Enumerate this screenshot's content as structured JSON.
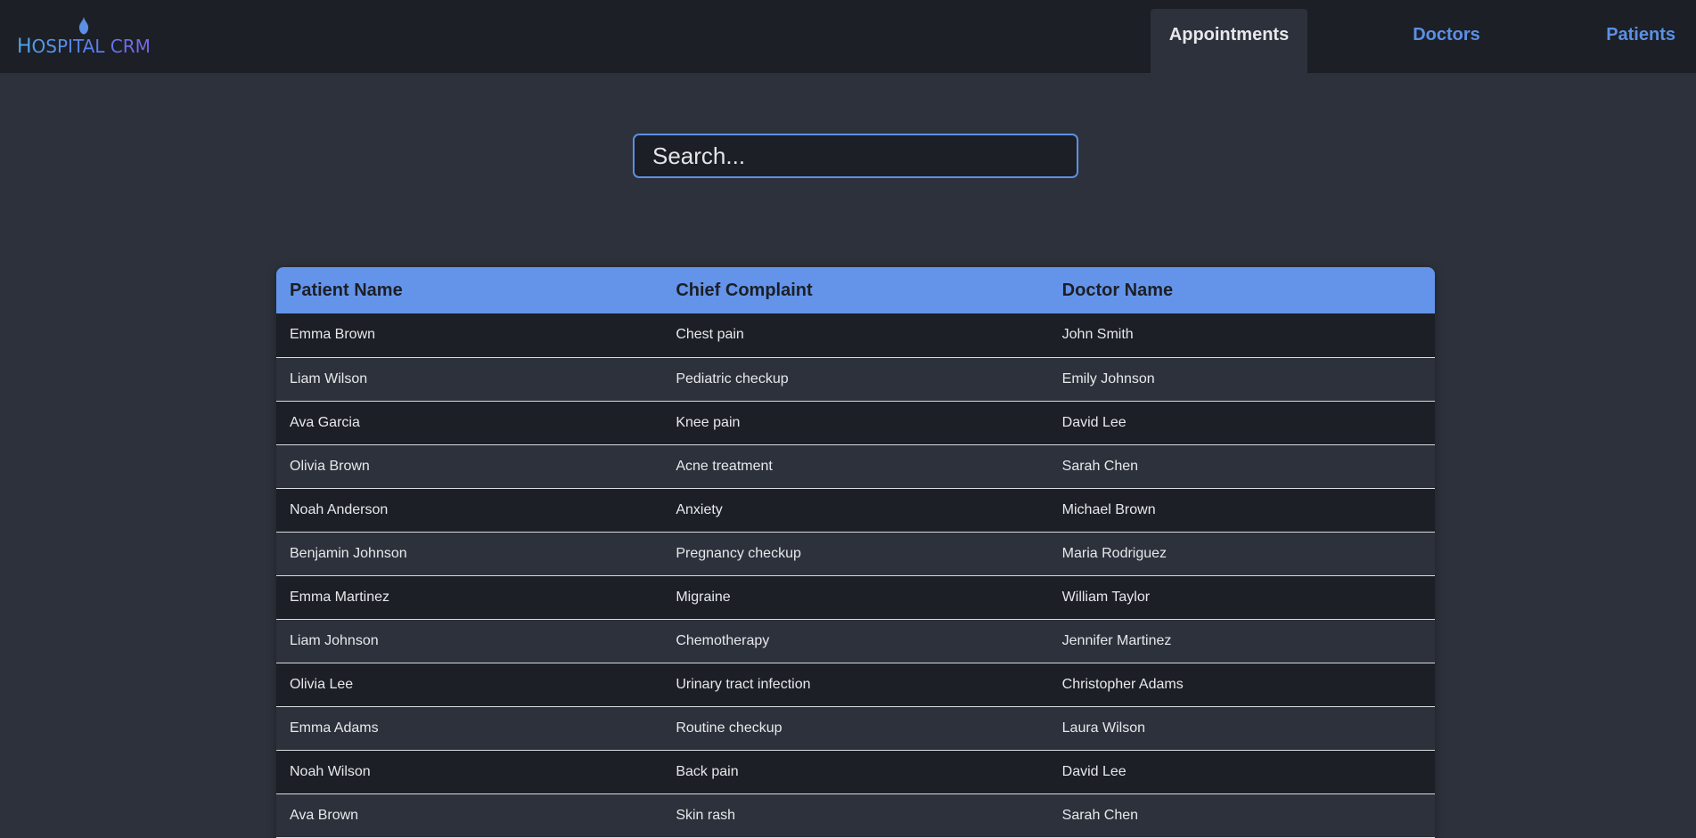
{
  "app": {
    "logo_text_first": "H",
    "logo_text_rest": "OSPITAL CRM",
    "brand_color": "#5b90e6"
  },
  "nav": {
    "items": [
      {
        "label": "Appointments",
        "active": true
      },
      {
        "label": "Doctors",
        "active": false
      },
      {
        "label": "Patients",
        "active": false
      }
    ]
  },
  "search": {
    "placeholder": "Search...",
    "value": ""
  },
  "table": {
    "columns": [
      "Patient Name",
      "Chief Complaint",
      "Doctor Name"
    ],
    "rows": [
      [
        "Emma Brown",
        "Chest pain",
        "John Smith"
      ],
      [
        "Liam Wilson",
        "Pediatric checkup",
        "Emily Johnson"
      ],
      [
        "Ava Garcia",
        "Knee pain",
        "David Lee"
      ],
      [
        "Olivia Brown",
        "Acne treatment",
        "Sarah Chen"
      ],
      [
        "Noah Anderson",
        "Anxiety",
        "Michael Brown"
      ],
      [
        "Benjamin Johnson",
        "Pregnancy checkup",
        "Maria Rodriguez"
      ],
      [
        "Emma Martinez",
        "Migraine",
        "William Taylor"
      ],
      [
        "Liam Johnson",
        "Chemotherapy",
        "Jennifer Martinez"
      ],
      [
        "Olivia Lee",
        "Urinary tract infection",
        "Christopher Adams"
      ],
      [
        "Emma Adams",
        "Routine checkup",
        "Laura Wilson"
      ],
      [
        "Noah Wilson",
        "Back pain",
        "David Lee"
      ],
      [
        "Ava Brown",
        "Skin rash",
        "Sarah Chen"
      ]
    ]
  }
}
